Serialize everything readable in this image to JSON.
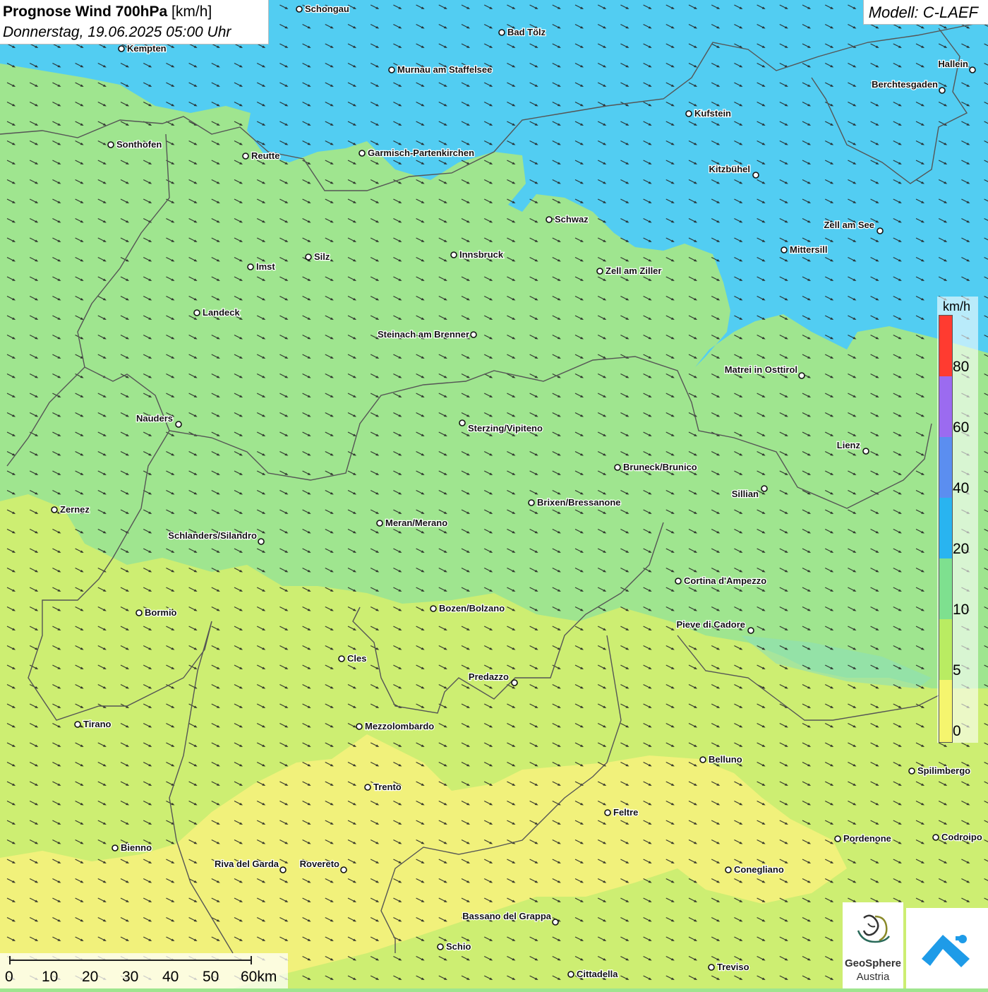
{
  "title": {
    "main": "Prognose Wind 700hPa",
    "unit": "[km/h]",
    "date": "Donnerstag, 19.06.2025 05:00 Uhr"
  },
  "model": "Modell: C-LAEF",
  "legend": {
    "unit": "km/h",
    "ticks": [
      "80",
      "60",
      "40",
      "20",
      "10",
      "5",
      "0"
    ],
    "colors": [
      "#ff3b30",
      "#9b6bf0",
      "#5b8ef0",
      "#29b4f0",
      "#7ee08f",
      "#b9ec62",
      "#f5f56e"
    ]
  },
  "scalebar": [
    "0",
    "10",
    "20",
    "30",
    "40",
    "50",
    "60km"
  ],
  "colors": {
    "blue_zone": "#52cdf2",
    "green_zone": "#9fe58f",
    "yellowgreen_zone": "#cdee72",
    "yellow_zone": "#f1f17b",
    "border": "#555555"
  },
  "cities": [
    "Schongau",
    "Bad Tölz",
    "Kempten",
    "Murnau am Staffelsee",
    "Hallein",
    "Berchtesgaden",
    "Kufstein",
    "Sonthofen",
    "Reutte",
    "Garmisch-Partenkirchen",
    "Kitzbühel",
    "Schwaz",
    "Zell am See",
    "Mittersill",
    "Innsbruck",
    "Silz",
    "Imst",
    "Zell am Ziller",
    "Landeck",
    "Steinach am Brenner",
    "Matrei in Osttirol",
    "Nauders",
    "Sterzing/Vipiteno",
    "Lienz",
    "Bruneck/Brunico",
    "Sillian",
    "Brixen/Bressanone",
    "Zernez",
    "Meran/Merano",
    "Schlanders/Silandro",
    "Cortina d'Ampezzo",
    "Bozen/Bolzano",
    "Bormio",
    "Pieve di Cadore",
    "Cles",
    "Predazzo",
    "Tirano",
    "Mezzolombardo",
    "Belluno",
    "Spilimbergo",
    "Trento",
    "Feltre",
    "Pordenone",
    "Codroipo",
    "Bienno",
    "Riva del Garda",
    "Rovereto",
    "Conegliano",
    "Bassano del Grappa",
    "Schio",
    "Treviso",
    "Cittadella"
  ],
  "logos": {
    "geosphere_name": "GeoSphere",
    "geosphere_sub": "Austria"
  }
}
